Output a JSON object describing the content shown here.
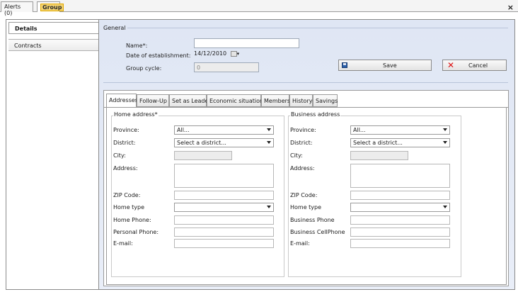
{
  "doc_tabs": {
    "alerts_label": "Alerts (0)",
    "group_label": "Group"
  },
  "close_label": "×",
  "nav": {
    "details_label": "Details",
    "contracts_label": "Contracts"
  },
  "general": {
    "legend": "General",
    "name_label": "Name*:",
    "name_value": "",
    "date_label": "Date of establishment:",
    "date_value": "14/12/2010",
    "cycle_label": "Group cycle:",
    "cycle_value": "0"
  },
  "buttons": {
    "save_label": "Save",
    "cancel_label": "Cancel"
  },
  "tabs": [
    "Addresses",
    "Follow-Up",
    "Set as Leader",
    "Economic situation",
    "Members",
    "History",
    "Savings"
  ],
  "home": {
    "title": "Home address*",
    "province_label": "Province:",
    "province_value": "All...",
    "district_label": "District:",
    "district_value": "Select a district...",
    "city_label": "City:",
    "address_label": "Address:",
    "zip_label": "ZIP Code:",
    "hometype_label": "Home type",
    "hometype_value": "",
    "phone_label": "Home Phone:",
    "personal_label": "Personal Phone:",
    "email_label": "E-mail:"
  },
  "business": {
    "title": "Business address",
    "province_label": "Province:",
    "province_value": "All...",
    "district_label": "District:",
    "district_value": "Select a district...",
    "city_label": "City:",
    "address_label": "Address:",
    "zip_label": "ZIP Code:",
    "hometype_label": "Home type",
    "hometype_value": "",
    "phone_label": "Business Phone",
    "cell_label": "Business CellPhone",
    "email_label": "E-mail:"
  }
}
